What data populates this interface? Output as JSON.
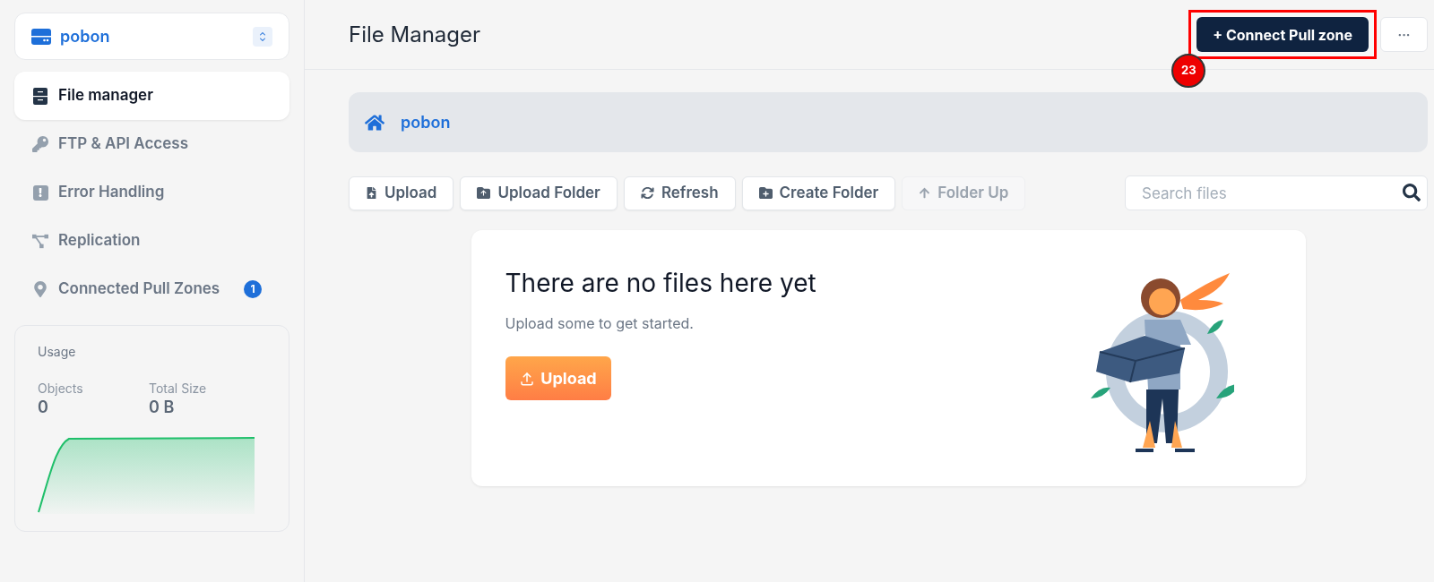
{
  "zone_selector": {
    "name": "pobon"
  },
  "sidebar": {
    "items": [
      {
        "label": "File manager",
        "selected": true
      },
      {
        "label": "FTP & API Access",
        "selected": false
      },
      {
        "label": "Error Handling",
        "selected": false
      },
      {
        "label": "Replication",
        "selected": false
      },
      {
        "label": "Connected Pull Zones",
        "selected": false,
        "badge": "1"
      }
    ]
  },
  "usage": {
    "title": "Usage",
    "stats": [
      {
        "label": "Objects",
        "value": "0"
      },
      {
        "label": "Total Size",
        "value": "0 B"
      }
    ]
  },
  "header": {
    "title": "File Manager",
    "primary_button": "+ Connect Pull zone",
    "more_button": "···",
    "step_marker": "23"
  },
  "breadcrumb": {
    "path": "pobon"
  },
  "toolbar": [
    {
      "label": "Upload",
      "disabled": false
    },
    {
      "label": "Upload Folder",
      "disabled": false
    },
    {
      "label": "Refresh",
      "disabled": false
    },
    {
      "label": "Create Folder",
      "disabled": false
    },
    {
      "label": "Folder Up",
      "disabled": true
    }
  ],
  "search": {
    "placeholder": "Search files"
  },
  "empty_state": {
    "title": "There are no files here yet",
    "subtitle": "Upload some to get started.",
    "button": "Upload"
  }
}
